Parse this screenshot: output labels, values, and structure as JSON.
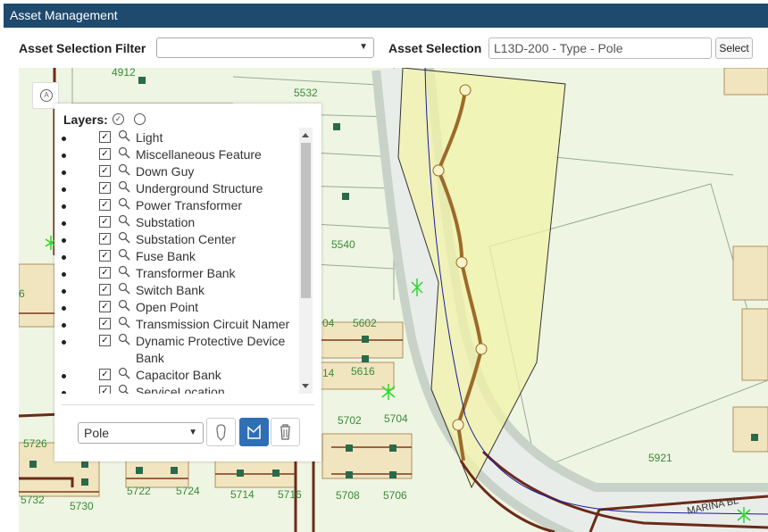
{
  "app": {
    "title": "Asset Management"
  },
  "filter": {
    "filter_label": "Asset Selection Filter",
    "filter_value": "",
    "selection_label": "Asset Selection",
    "selection_value": "L13D-200 - Type - Pole",
    "select_button": "Select"
  },
  "layers": {
    "heading": "Layers:",
    "items": [
      {
        "label": "Light",
        "checked": true
      },
      {
        "label": "Miscellaneous Feature",
        "checked": true
      },
      {
        "label": "Down Guy",
        "checked": true
      },
      {
        "label": "Underground Structure",
        "checked": true
      },
      {
        "label": "Power Transformer",
        "checked": true
      },
      {
        "label": "Substation",
        "checked": true
      },
      {
        "label": "Substation Center",
        "checked": true
      },
      {
        "label": "Fuse Bank",
        "checked": true
      },
      {
        "label": "Transformer Bank",
        "checked": true
      },
      {
        "label": "Switch Bank",
        "checked": true
      },
      {
        "label": "Open Point",
        "checked": true
      },
      {
        "label": "Transmission Circuit Namer",
        "checked": true
      },
      {
        "label": "Dynamic Protective Device Bank",
        "checked": true
      },
      {
        "label": "Capacitor Bank",
        "checked": true
      },
      {
        "label": "ServiceLocation",
        "checked": true
      }
    ],
    "type_select_value": "Pole"
  },
  "map": {
    "labels": [
      "4912",
      "5532",
      "5540",
      "6",
      "04",
      "5602",
      "14",
      "5616",
      "5702",
      "5704",
      "5726",
      "5732",
      "5730",
      "5722",
      "5724",
      "5714",
      "5716",
      "5708",
      "5706",
      "5921",
      "MARINA BL"
    ]
  }
}
